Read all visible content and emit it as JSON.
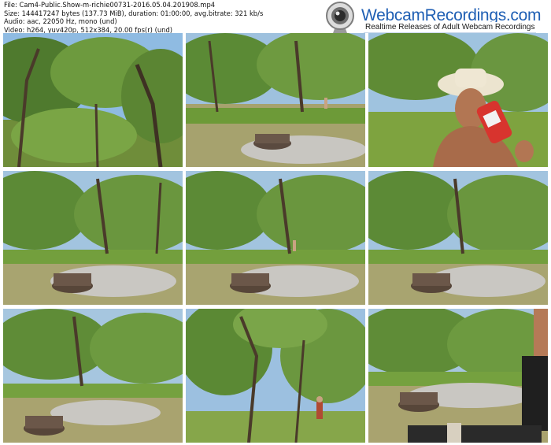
{
  "meta": {
    "file_line": "File: Cam4-Public.Show-m-richie00731-2016.05.04.201908.mp4",
    "size_line": "Size: 144417247 bytes (137.73 MiB), duration: 01:00:00, avg.bitrate: 321 kb/s",
    "audio_line": "Audio: aac, 22050 Hz, mono (und)",
    "video_line": "Video: h264, yuv420p, 512x384, 20.00 fps(r) (und)"
  },
  "logo": {
    "brand_text": "WebcamRecordings.com",
    "tagline": "Realtime Releases of Adult Webcam Recordings",
    "icon": "webcam-icon",
    "brand_color": "#1f5fb4"
  },
  "thumbnails": [
    {
      "scene": "forest-canopy"
    },
    {
      "scene": "fire-pit-clearing-person-distance"
    },
    {
      "scene": "man-cowboy-hat-drinking"
    },
    {
      "scene": "fire-pit-clearing"
    },
    {
      "scene": "fire-pit-clearing-person-distance"
    },
    {
      "scene": "fire-pit-clearing"
    },
    {
      "scene": "fire-pit-clearing"
    },
    {
      "scene": "trees-person-walking"
    },
    {
      "scene": "fire-pit-clearing-person-near"
    }
  ]
}
